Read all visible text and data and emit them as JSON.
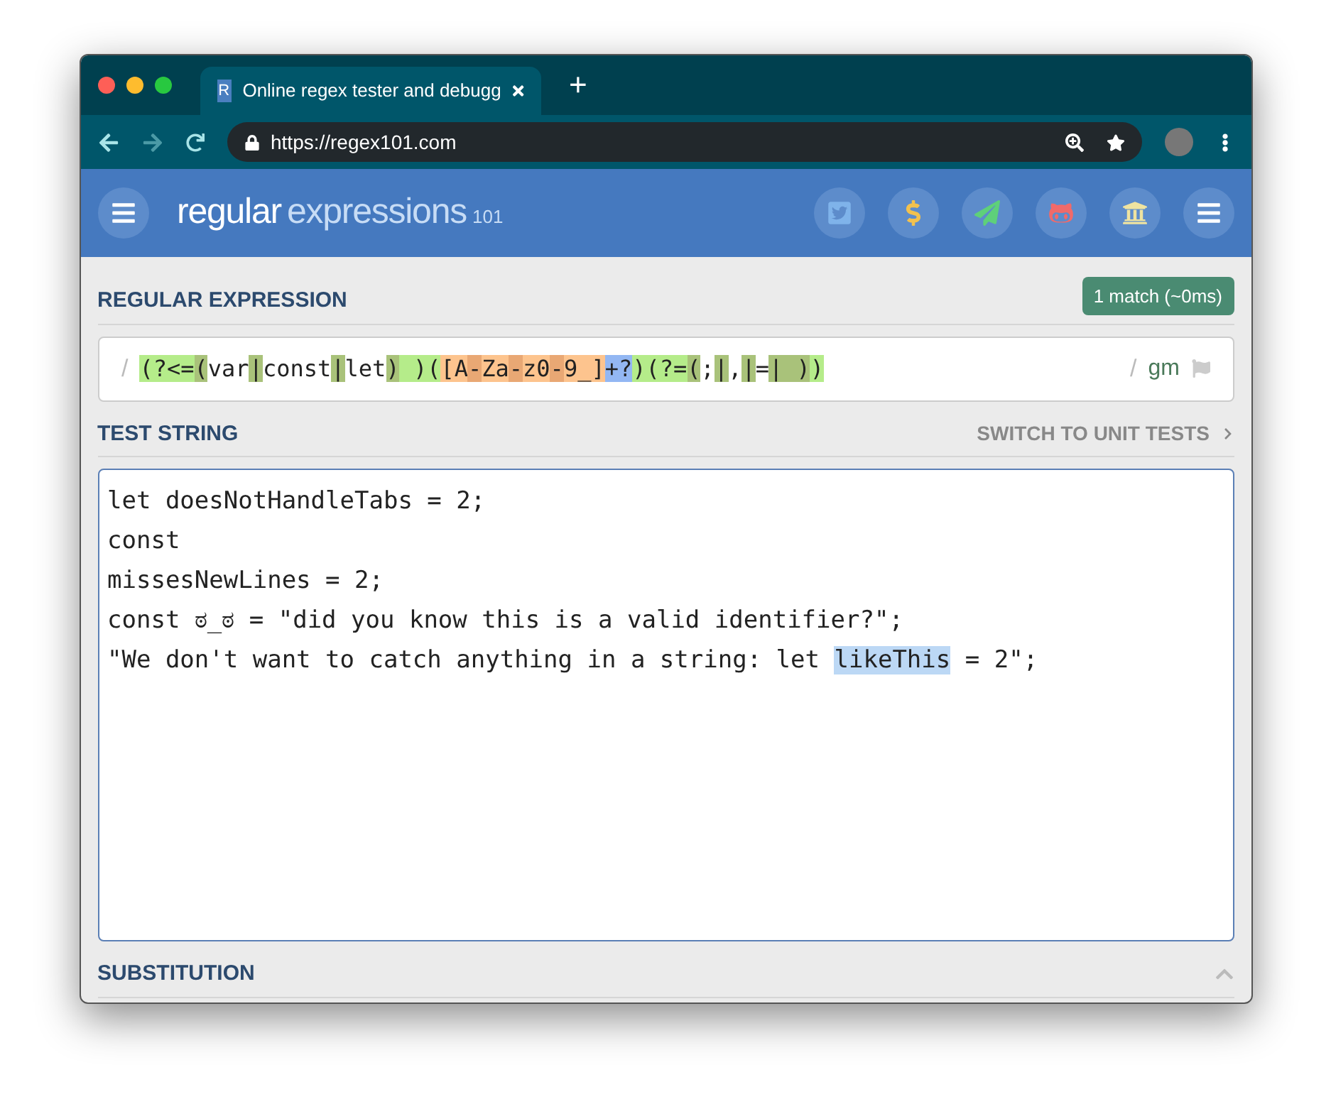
{
  "browser": {
    "tab_title": "Online regex tester and debugg",
    "tab_favicon": "R",
    "new_tab": "+",
    "url": "https://regex101.com"
  },
  "header": {
    "logo_main": "regular",
    "logo_sub": "expressions",
    "logo_num": "101"
  },
  "regex_section": {
    "title": "REGULAR EXPRESSION",
    "match_badge": "1 match (~0ms)",
    "delimiter_open": "/",
    "delimiter_close": "/",
    "flags": "gm",
    "tokens": [
      {
        "text": "(?<=",
        "kind": "look"
      },
      {
        "text": "(",
        "kind": "group"
      },
      {
        "text": "var",
        "kind": "text"
      },
      {
        "text": "|",
        "kind": "group"
      },
      {
        "text": "const",
        "kind": "text"
      },
      {
        "text": "|",
        "kind": "group"
      },
      {
        "text": "let",
        "kind": "text"
      },
      {
        "text": ")",
        "kind": "group"
      },
      {
        "text": " )(",
        "kind": "look"
      },
      {
        "text": "[A",
        "kind": "class"
      },
      {
        "text": "-",
        "kind": "range"
      },
      {
        "text": "Za",
        "kind": "class"
      },
      {
        "text": "-",
        "kind": "range"
      },
      {
        "text": "z0",
        "kind": "class"
      },
      {
        "text": "-",
        "kind": "range"
      },
      {
        "text": "9_]",
        "kind": "class"
      },
      {
        "text": "+?",
        "kind": "quant"
      },
      {
        "text": ")(?=",
        "kind": "look"
      },
      {
        "text": "(",
        "kind": "group"
      },
      {
        "text": ";",
        "kind": "text"
      },
      {
        "text": "|",
        "kind": "group"
      },
      {
        "text": ",",
        "kind": "text"
      },
      {
        "text": "|",
        "kind": "group"
      },
      {
        "text": "=",
        "kind": "text"
      },
      {
        "text": "|",
        "kind": "group"
      },
      {
        "text": " )",
        "kind": "group"
      },
      {
        "text": ")",
        "kind": "look"
      }
    ]
  },
  "test_section": {
    "title": "TEST STRING",
    "switch_link": "SWITCH TO UNIT TESTS",
    "lines": [
      [
        {
          "text": "let doesNotHandleTabs = 2;",
          "match": false
        }
      ],
      [
        {
          "text": "const",
          "match": false
        }
      ],
      [
        {
          "text": "missesNewLines = 2;",
          "match": false
        }
      ],
      [
        {
          "text": "const ಠ_ಠ = \"did you know this is a valid identifier?\";",
          "match": false
        }
      ],
      [
        {
          "text": "\"We don't want to catch anything in a string: let ",
          "match": false
        },
        {
          "text": "likeThis",
          "match": true
        },
        {
          "text": " = 2\";",
          "match": false
        }
      ]
    ]
  },
  "substitution": {
    "title": "SUBSTITUTION",
    "expanded": false
  }
}
